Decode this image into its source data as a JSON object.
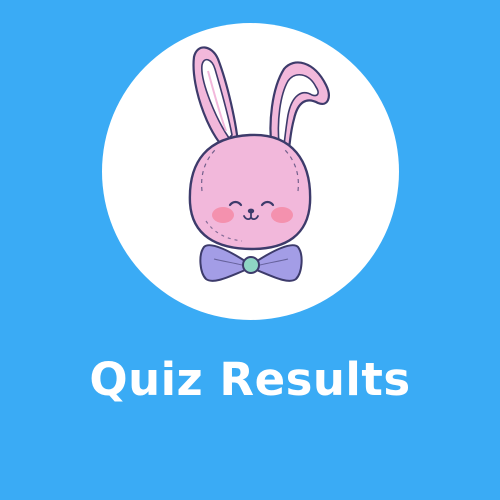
{
  "title": "Quiz Results",
  "colors": {
    "background": "#3aabf5",
    "circle": "#ffffff",
    "bunny_fill": "#f2b8db",
    "bunny_outline": "#3d3b6b",
    "ear_inner": "#ffffff",
    "cheeks": "#f58aa6",
    "bow": "#a39de6",
    "bow_center": "#8fd6c4"
  },
  "illustration": {
    "icon": "bunny-with-bow-tie"
  }
}
